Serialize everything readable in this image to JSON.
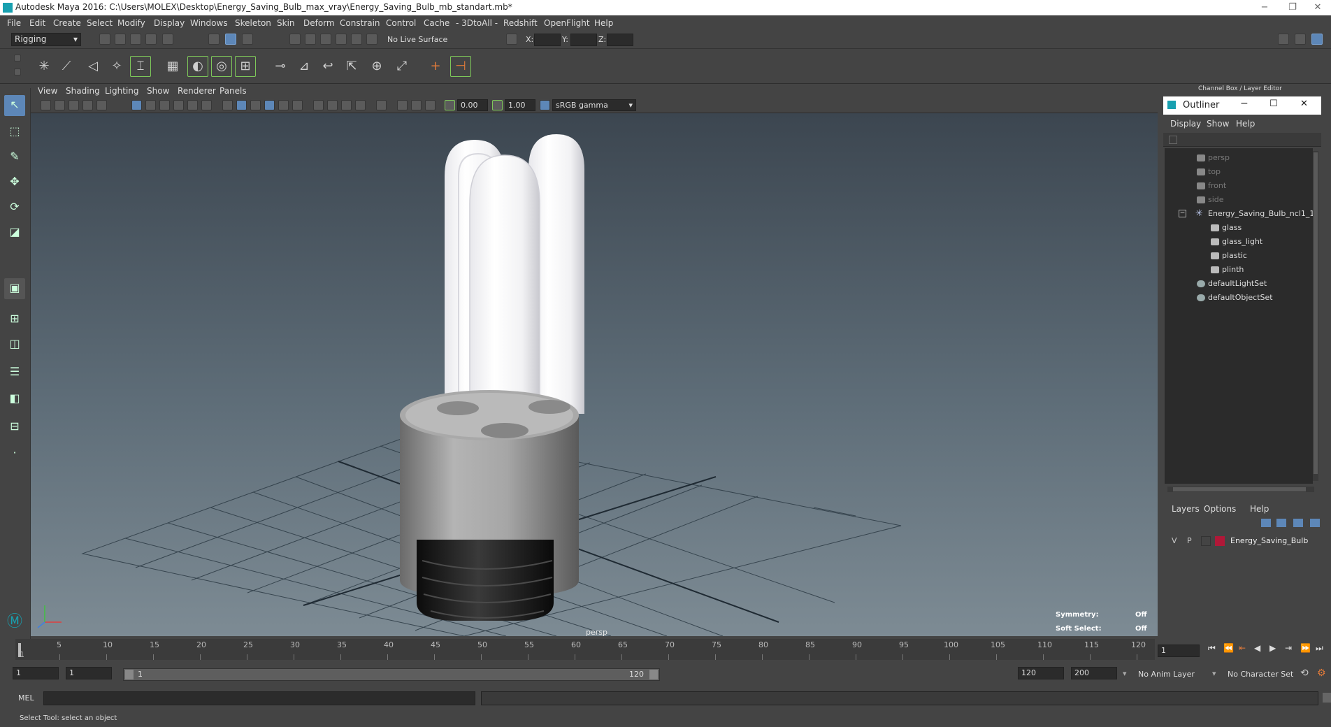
{
  "window": {
    "title": "Autodesk Maya 2016: C:\\Users\\MOLEX\\Desktop\\Energy_Saving_Bulb_max_vray\\Energy_Saving_Bulb_mb_standart.mb*",
    "minimize": "−",
    "restore": "❐",
    "close": "✕"
  },
  "menubar": [
    "File",
    "Edit",
    "Create",
    "Select",
    "Modify",
    "Display",
    "Windows",
    "Skeleton",
    "Skin",
    "Deform",
    "Constrain",
    "Control",
    "Cache",
    "- 3DtoAll -",
    "Redshift",
    "OpenFlight",
    "Help"
  ],
  "statusline": {
    "mode": "Rigging",
    "live_surface": "No Live Surface",
    "x_label": "X:",
    "y_label": "Y:",
    "z_label": "Z:"
  },
  "viewport": {
    "menu": [
      "View",
      "Shading",
      "Lighting",
      "Show",
      "Renderer",
      "Panels"
    ],
    "exposure": "0.00",
    "gamma": "1.00",
    "color_space": "sRGB gamma",
    "camera": "persp",
    "symmetry_label": "Symmetry:",
    "symmetry_value": "Off",
    "softselect_label": "Soft Select:",
    "softselect_value": "Off"
  },
  "channelbox": {
    "title": "Channel Box / Layer Editor"
  },
  "outliner": {
    "title": "Outliner",
    "menu": [
      "Display",
      "Show",
      "Help"
    ],
    "items": [
      {
        "label": "persp",
        "dim": true
      },
      {
        "label": "top",
        "dim": true
      },
      {
        "label": "front",
        "dim": true
      },
      {
        "label": "side",
        "dim": true
      },
      {
        "label": "Energy_Saving_Bulb_ncl1_1",
        "dim": false
      },
      {
        "label": "glass",
        "dim": false
      },
      {
        "label": "glass_light",
        "dim": false
      },
      {
        "label": "plastic",
        "dim": false
      },
      {
        "label": "plinth",
        "dim": false
      },
      {
        "label": "defaultLightSet",
        "dim": false
      },
      {
        "label": "defaultObjectSet",
        "dim": false
      }
    ]
  },
  "layers": {
    "menu": [
      "Layers",
      "Options",
      "Help"
    ],
    "row": {
      "v": "V",
      "p": "P",
      "name": "Energy_Saving_Bulb",
      "color": "#b01838"
    }
  },
  "timeline": {
    "ticks": [
      "5",
      "10",
      "15",
      "20",
      "25",
      "30",
      "35",
      "40",
      "45",
      "50",
      "55",
      "60",
      "65",
      "70",
      "75",
      "80",
      "85",
      "90",
      "95",
      "100",
      "105",
      "110",
      "115",
      "120"
    ],
    "start_marker": "1",
    "current_frame": "1"
  },
  "range": {
    "start": "1",
    "anim_start": "1",
    "slider_start": "1",
    "slider_end": "120",
    "anim_end": "120",
    "end": "200",
    "anim_layer": "No Anim Layer",
    "char_set": "No Character Set"
  },
  "cmdline": {
    "label": "MEL"
  },
  "helpline": {
    "text": "Select Tool: select an object"
  },
  "colors": {
    "accent": "#5d87b8",
    "maya_teal": "#18a0b0"
  }
}
